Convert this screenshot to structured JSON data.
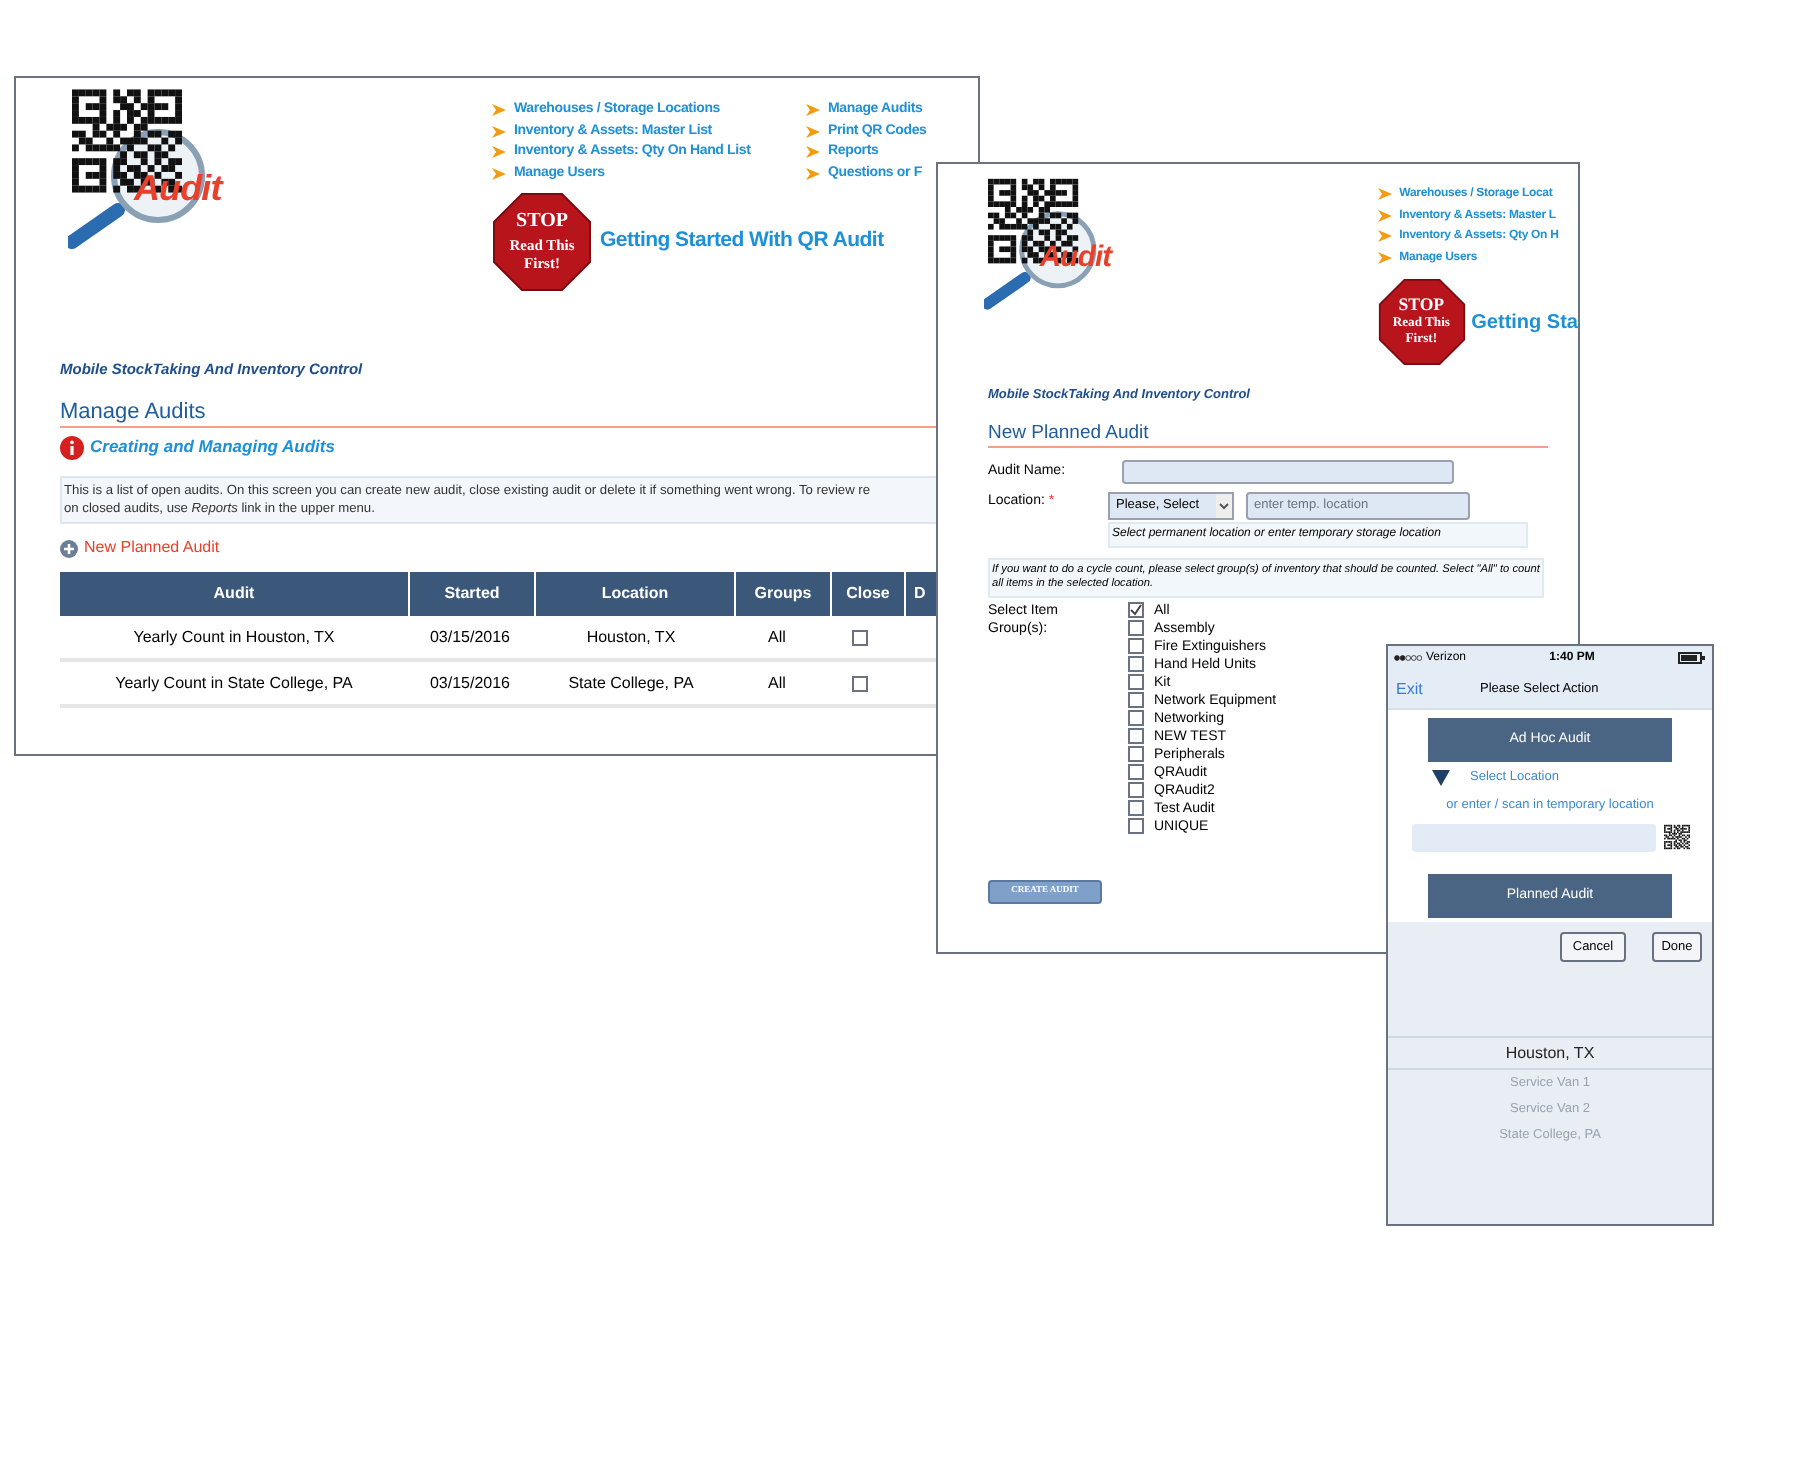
{
  "main_window": {
    "logo_text": "Audit",
    "nav_links": [
      {
        "label": "Warehouses / Storage Locations"
      },
      {
        "label": "Inventory & Assets: Master List"
      },
      {
        "label": "Inventory & Assets: Qty On Hand List"
      },
      {
        "label": "Manage Users"
      },
      {
        "label": "Manage Audits"
      },
      {
        "label": "Print QR Codes"
      },
      {
        "label": "Reports"
      },
      {
        "label": "Questions or F"
      }
    ],
    "stop_sign": [
      "STOP",
      "Read This",
      "First!"
    ],
    "getting_started": "Getting Started With QR Audit",
    "tagline": "Mobile StockTaking And Inventory Control",
    "page_title": "Manage Audits",
    "help_link": "Creating and Managing Audits",
    "description": [
      "This is a list of open audits. On this screen you can create new audit, close existing audit or delete it if something went wrong. To review re",
      "on closed audits, use *Reports* link in the upper menu."
    ],
    "new_audit_link": "New Planned Audit",
    "table": {
      "columns": [
        "Audit",
        "Started",
        "Location",
        "Groups",
        "Close",
        "D"
      ],
      "rows": [
        {
          "audit": "Yearly Count in Houston, TX",
          "started": "03/15/2016",
          "location": "Houston, TX",
          "groups": "All",
          "close": false
        },
        {
          "audit": "Yearly Count in State College, PA",
          "started": "03/15/2016",
          "location": "State College, PA",
          "groups": "All",
          "close": false
        }
      ]
    }
  },
  "form_window": {
    "logo_text": "Audit",
    "nav_links": [
      {
        "label": "Warehouses / Storage Locat"
      },
      {
        "label": "Inventory & Assets: Master L"
      },
      {
        "label": "Inventory & Assets: Qty On H"
      },
      {
        "label": "Manage Users"
      }
    ],
    "stop_sign": [
      "STOP",
      "Read This",
      "First!"
    ],
    "getting_started": "Getting Sta",
    "tagline": "Mobile StockTaking And Inventory Control",
    "page_title": "New Planned Audit",
    "audit_name_label": "Audit Name:",
    "location_label": "Location:",
    "required_mark": "*",
    "location_select": "Please, Select",
    "temp_location_placeholder": "enter temp. location",
    "location_hint": "Select permanent location or enter temporary storage location",
    "cycle_hint": "If you want to do a cycle count, please select group(s) of inventory that should be counted. Select \"All\" to count all items in the selected location.",
    "groups_label": "Select Item Group(s):",
    "groups": [
      {
        "label": "All",
        "checked": true
      },
      {
        "label": "Assembly",
        "checked": false
      },
      {
        "label": "Fire Extinguishers",
        "checked": false
      },
      {
        "label": "Hand Held Units",
        "checked": false
      },
      {
        "label": "Kit",
        "checked": false
      },
      {
        "label": "Network Equipment",
        "checked": false
      },
      {
        "label": "Networking",
        "checked": false
      },
      {
        "label": "NEW TEST",
        "checked": false
      },
      {
        "label": "Peripherals",
        "checked": false
      },
      {
        "label": "QRAudit",
        "checked": false
      },
      {
        "label": "QRAudit2",
        "checked": false
      },
      {
        "label": "Test Audit",
        "checked": false
      },
      {
        "label": "UNIQUE",
        "checked": false
      }
    ],
    "create_button": "CREATE AUDIT"
  },
  "phone": {
    "carrier": "Verizon",
    "time": "1:40 PM",
    "exit": "Exit",
    "title": "Please Select Action",
    "ad_hoc_button": "Ad Hoc Audit",
    "select_location": "Select Location",
    "scan_hint": "or enter / scan in temporary location",
    "planned_button": "Planned Audit",
    "cancel": "Cancel",
    "done": "Done",
    "picker": [
      {
        "label": "Houston, TX",
        "selected": true
      },
      {
        "label": "Service Van 1",
        "selected": false
      },
      {
        "label": "Service Van 2",
        "selected": false
      },
      {
        "label": "State College, PA",
        "selected": false
      }
    ]
  }
}
